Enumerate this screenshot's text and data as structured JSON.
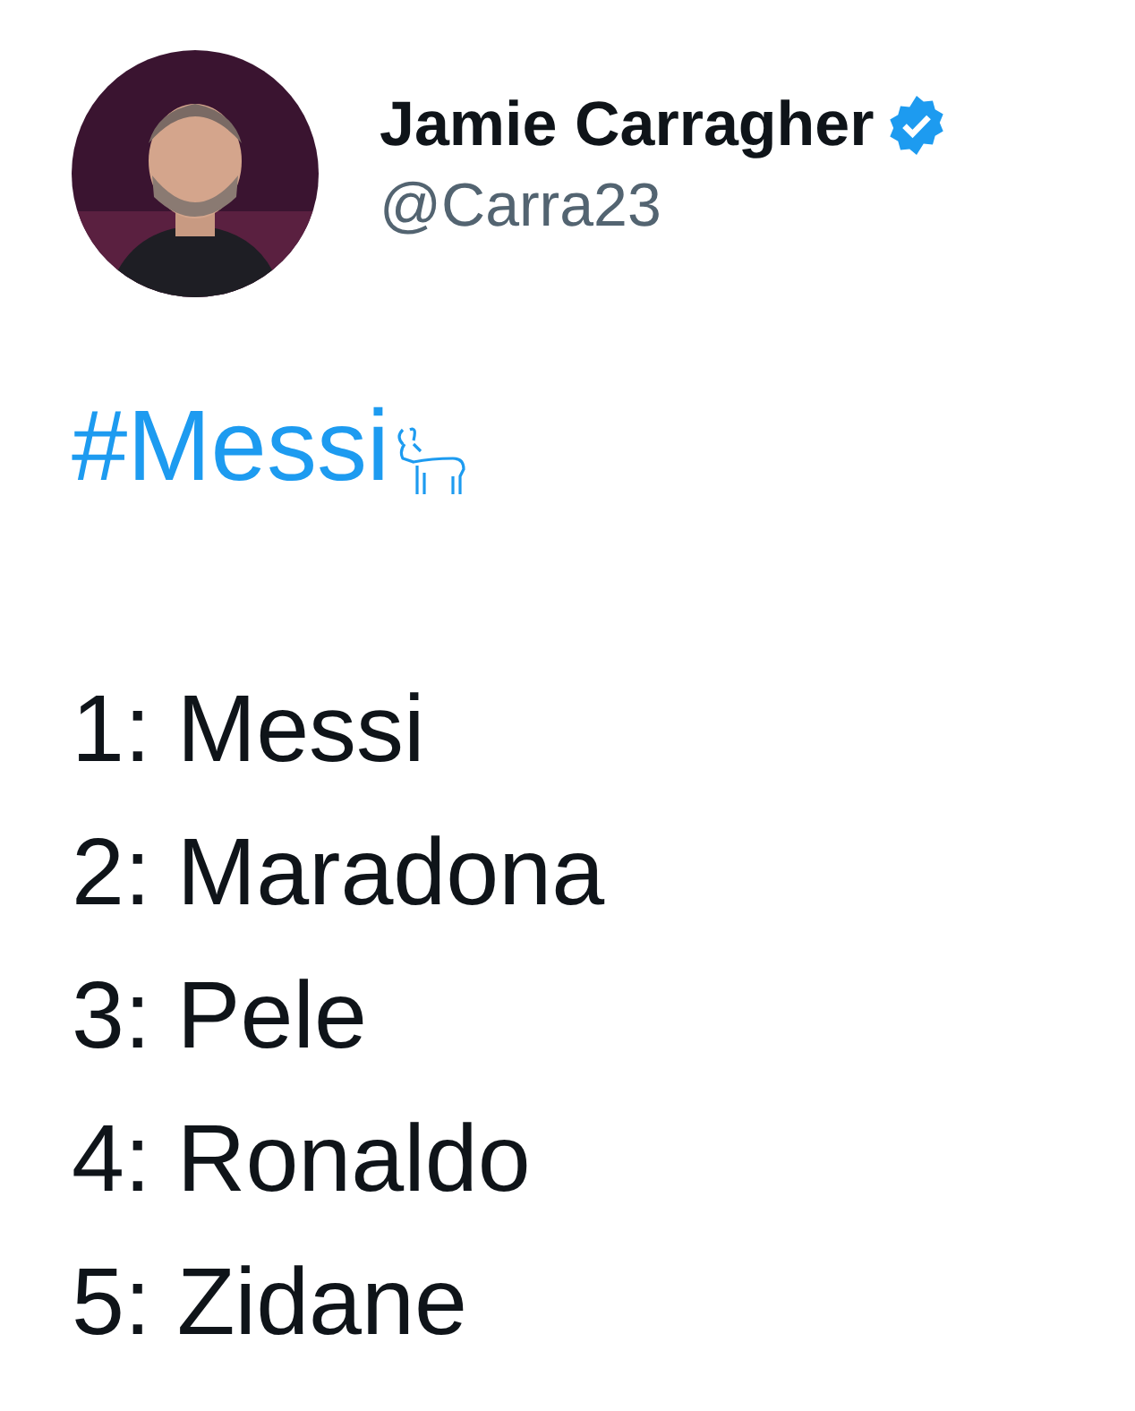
{
  "author": {
    "name": "Jamie Carragher",
    "handle": "@Carra23",
    "verified": true
  },
  "hashtag": "#Messi",
  "lines": [
    "1: Messi",
    "2: Maradona",
    "3: Pele",
    "4: Ronaldo",
    "5: Zidane"
  ]
}
